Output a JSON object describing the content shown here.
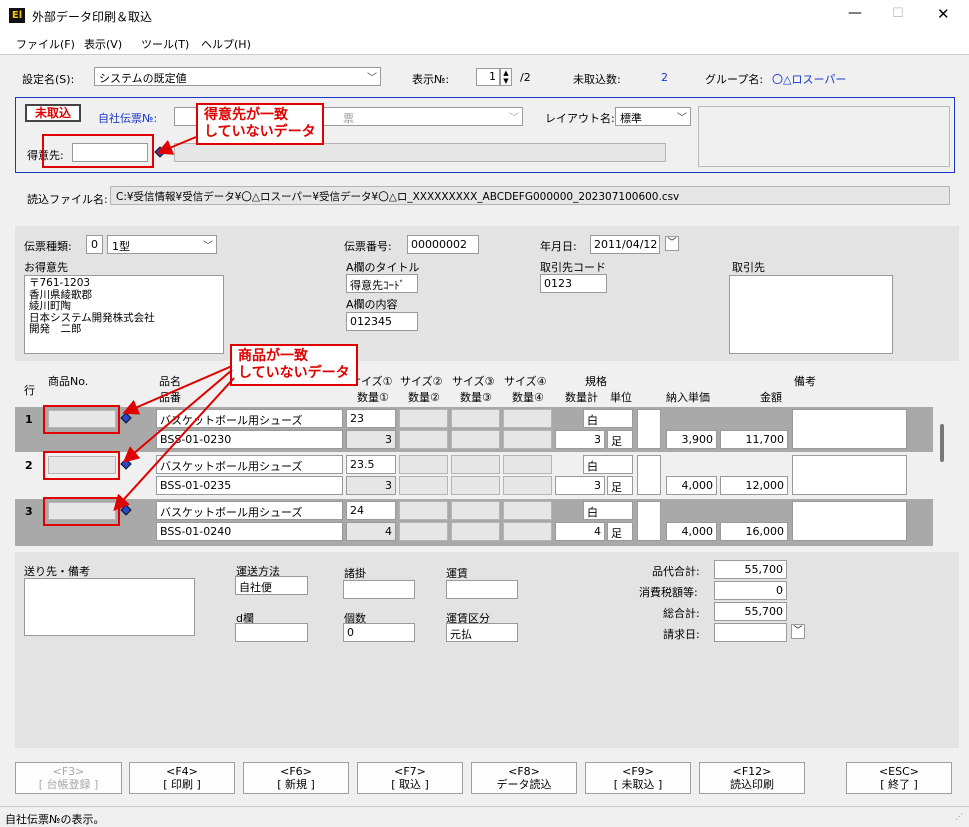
{
  "window": {
    "title": "外部データ印刷＆取込"
  },
  "menu": [
    "ファイル(F)",
    "表示(V)",
    "ツール(T)",
    "ヘルプ(H)"
  ],
  "top": {
    "setting_label": "設定名(S):",
    "setting_value": "システムの既定値",
    "display_label": "表示№:",
    "display_value": "1",
    "display_total": "/2",
    "unimported_label": "未取込数:",
    "unimported_value": "2",
    "group_label": "グループ名:",
    "group_value": "〇△ロスーパー"
  },
  "status_panel": {
    "badge": "未取込",
    "slip_label": "自社伝票№:",
    "slip_blurred": "票",
    "layout_label": "レイアウト名:",
    "layout_value": "標準",
    "customer_label": "得意先:"
  },
  "read_file": {
    "label": "読込ファイル名:",
    "value": "C:¥受信情報¥受信データ¥〇△ロスーパー¥受信データ¥〇△ロ_XXXXXXXXX_ABCDEFG000000_202307100600.csv"
  },
  "slip": {
    "type_label": "伝票種類:",
    "type_code": "0",
    "type_value": "1型",
    "number_label": "伝票番号:",
    "number_value": "00000002",
    "date_label": "年月日:",
    "date_value": "2011/04/12",
    "customer_label": "お得意先",
    "customer_lines": [
      "〒761-1203",
      "香川県綾歌郡",
      "綾川町陶",
      "日本システム開発株式会社",
      "開発　二郎"
    ],
    "a_title_label": "A欄のタイトル",
    "a_title_value": "得意先ｺｰﾄﾞ",
    "a_content_label": "A欄の内容",
    "a_content_value": "012345",
    "partner_code_label": "取引先コード",
    "partner_code_value": "0123",
    "partner_label": "取引先"
  },
  "grid_headers": {
    "row": "行",
    "product_no": "商品No.",
    "name": "品名",
    "code": "品番",
    "size1": "サイズ①",
    "size2": "サイズ②",
    "size3": "サイズ③",
    "size4": "サイズ④",
    "qty1": "数量①",
    "qty2": "数量②",
    "qty3": "数量③",
    "qty4": "数量④",
    "spec": "規格",
    "qty_total": "数量計",
    "unit": "単位",
    "unit_price": "納入単価",
    "amount": "金額",
    "remarks": "備考"
  },
  "rows": [
    {
      "no": "1",
      "name": "バスケットボール用シューズ",
      "code": "BSS-01-0230",
      "size": "23",
      "qty": "3",
      "spec": "白",
      "total": "3",
      "unit": "足",
      "price": "3,900",
      "amount": "11,700"
    },
    {
      "no": "2",
      "name": "バスケットボール用シューズ",
      "code": "BSS-01-0235",
      "size": "23.5",
      "qty": "3",
      "spec": "白",
      "total": "3",
      "unit": "足",
      "price": "4,000",
      "amount": "12,000"
    },
    {
      "no": "3",
      "name": "バスケットボール用シューズ",
      "code": "BSS-01-0240",
      "size": "24",
      "qty": "4",
      "spec": "白",
      "total": "4",
      "unit": "足",
      "price": "4,000",
      "amount": "16,000"
    }
  ],
  "footer": {
    "dest_label": "送り先・備考",
    "method_label": "運送方法",
    "method_value": "自社便",
    "misc_label": "諸掛",
    "fare_label": "運賃",
    "d_label": "d欄",
    "count_label": "個数",
    "count_value": "0",
    "fare_type_label": "運賃区分",
    "fare_type_value": "元払",
    "goods_total_label": "品代合計:",
    "goods_total_value": "55,700",
    "tax_label": "消費税額等:",
    "tax_value": "0",
    "grand_total_label": "総合計:",
    "grand_total_value": "55,700",
    "bill_date_label": "請求日:"
  },
  "buttons": [
    {
      "key": "<F3>",
      "label": "[ 台帳登録 ]"
    },
    {
      "key": "<F4>",
      "label": "[ 印刷 ]"
    },
    {
      "key": "<F6>",
      "label": "[ 新規 ]"
    },
    {
      "key": "<F7>",
      "label": "[ 取込 ]"
    },
    {
      "key": "<F8>",
      "label": "データ読込"
    },
    {
      "key": "<F9>",
      "label": "[ 未取込 ]"
    },
    {
      "key": "<F12>",
      "label": "読込印刷"
    },
    {
      "key": "<ESC>",
      "label": "[ 終了 ]"
    }
  ],
  "statusbar": "自社伝票№の表示。",
  "annotations": {
    "customer_mismatch": [
      "得意先が一致",
      "していないデータ"
    ],
    "product_mismatch": [
      "商品が一致",
      "していないデータ"
    ]
  },
  "colors": {
    "accent_blue": "#1a37c8",
    "annotation_red": "#e00000",
    "grid_band": "#a9a9a9"
  }
}
